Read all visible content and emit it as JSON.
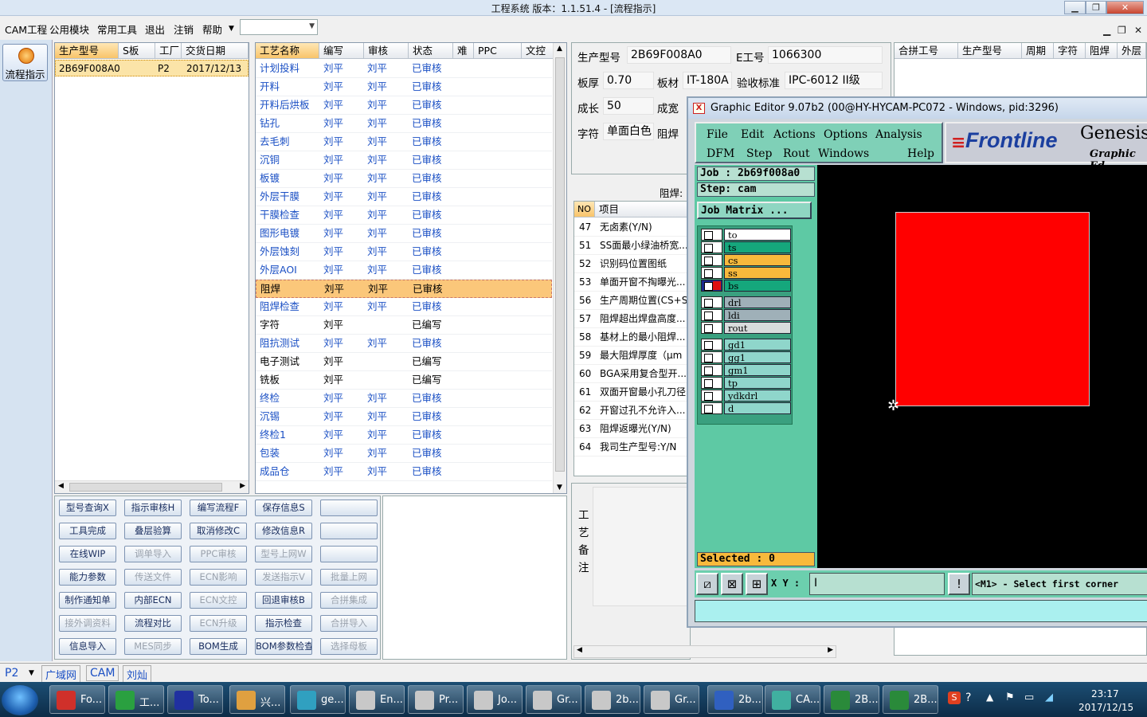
{
  "window": {
    "title": "工程系统    版本：1.1.51.4 - [流程指示]"
  },
  "menu": [
    "CAM工程",
    "公用模块",
    "常用工具",
    "退出",
    "注销",
    "帮助"
  ],
  "left_bar": {
    "flow_button": "流程指示"
  },
  "order_table": {
    "headers": [
      "生产型号",
      "S板",
      "工厂",
      "交货日期"
    ],
    "row": {
      "model": "2B69F008A0",
      "s": "",
      "factory": "P2",
      "date": "2017/12/13"
    }
  },
  "process_table": {
    "headers": [
      "工艺名称",
      "编写",
      "审核",
      "状态",
      "难",
      "PPC",
      "文控"
    ],
    "rows": [
      {
        "name": "计划投料",
        "writer": "刘平",
        "reviewer": "刘平",
        "status": "已审核"
      },
      {
        "name": "开料",
        "writer": "刘平",
        "reviewer": "刘平",
        "status": "已审核"
      },
      {
        "name": "开料后烘板",
        "writer": "刘平",
        "reviewer": "刘平",
        "status": "已审核"
      },
      {
        "name": "钻孔",
        "writer": "刘平",
        "reviewer": "刘平",
        "status": "已审核"
      },
      {
        "name": "去毛刺",
        "writer": "刘平",
        "reviewer": "刘平",
        "status": "已审核"
      },
      {
        "name": "沉铜",
        "writer": "刘平",
        "reviewer": "刘平",
        "status": "已审核"
      },
      {
        "name": "板镀",
        "writer": "刘平",
        "reviewer": "刘平",
        "status": "已审核"
      },
      {
        "name": "外层干膜",
        "writer": "刘平",
        "reviewer": "刘平",
        "status": "已审核"
      },
      {
        "name": "干膜检查",
        "writer": "刘平",
        "reviewer": "刘平",
        "status": "已审核"
      },
      {
        "name": "图形电镀",
        "writer": "刘平",
        "reviewer": "刘平",
        "status": "已审核"
      },
      {
        "name": "外层蚀刻",
        "writer": "刘平",
        "reviewer": "刘平",
        "status": "已审核"
      },
      {
        "name": "外层AOI",
        "writer": "刘平",
        "reviewer": "刘平",
        "status": "已审核"
      },
      {
        "name": "阻焊",
        "writer": "刘平",
        "reviewer": "刘平",
        "status": "已审核"
      },
      {
        "name": "阻焊检查",
        "writer": "刘平",
        "reviewer": "刘平",
        "status": "已审核"
      },
      {
        "name": "字符",
        "writer": "刘平",
        "reviewer": "",
        "status": "已编写"
      },
      {
        "name": "阻抗测试",
        "writer": "刘平",
        "reviewer": "刘平",
        "status": "已审核"
      },
      {
        "name": "电子测试",
        "writer": "刘平",
        "reviewer": "",
        "status": "已编写"
      },
      {
        "name": "铣板",
        "writer": "刘平",
        "reviewer": "",
        "status": "已编写"
      },
      {
        "name": "终检",
        "writer": "刘平",
        "reviewer": "刘平",
        "status": "已审核"
      },
      {
        "name": "沉锡",
        "writer": "刘平",
        "reviewer": "刘平",
        "status": "已审核"
      },
      {
        "name": "终检1",
        "writer": "刘平",
        "reviewer": "刘平",
        "status": "已审核"
      },
      {
        "name": "包装",
        "writer": "刘平",
        "reviewer": "刘平",
        "status": "已审核"
      },
      {
        "name": "成品仓",
        "writer": "刘平",
        "reviewer": "刘平",
        "status": "已审核"
      }
    ]
  },
  "buttons": [
    [
      "型号查询X",
      "指示审核H",
      "编写流程F",
      "保存信息S",
      ""
    ],
    [
      "工具完成",
      "叠层验算",
      "取消修改C",
      "修改信息R",
      ""
    ],
    [
      "在线WIP",
      "调单导入",
      "PPC审核",
      "型号上网W",
      ""
    ],
    [
      "能力参数",
      "传送文件",
      "ECN影响",
      "发送指示V",
      "批量上网"
    ],
    [
      "制作通知单",
      "内部ECN",
      "ECN文控",
      "回退审核B",
      "合拼集成"
    ],
    [
      "接外调资料",
      "流程对比",
      "ECN升级",
      "指示检查",
      "合拼导入"
    ],
    [
      "信息导入",
      "MES同步",
      "BOM生成",
      "BOM参数检查",
      "选择母板"
    ]
  ],
  "info": {
    "model_label": "生产型号",
    "model": "2B69F008A0",
    "eno_label": "E工号",
    "eno": "1066300",
    "thickness_label": "板厚",
    "thickness": "0.70",
    "material_label": "板材",
    "material": "IT-180A",
    "standard_label": "验收标准",
    "standard": "IPC-6012 II级",
    "length_label": "成长",
    "length": "50",
    "width_label": "成宽",
    "char_label": "字符",
    "char": "单面白色",
    "mask_label": "阻焊"
  },
  "right_table": {
    "headers": [
      "合拼工号",
      "生产型号",
      "周期",
      "字符",
      "阻焊",
      "外层"
    ]
  },
  "requirements": {
    "title": "阻焊:",
    "headers": [
      "NO",
      "项目"
    ],
    "rows": [
      {
        "no": "47",
        "item": "无卤素(Y/N)"
      },
      {
        "no": "51",
        "item": "SS面最小绿油桥宽..."
      },
      {
        "no": "52",
        "item": "识别码位置图纸"
      },
      {
        "no": "53",
        "item": "单面开窗不掏曝光..."
      },
      {
        "no": "56",
        "item": "生产周期位置(CS+S"
      },
      {
        "no": "57",
        "item": "阻焊超出焊盘高度..."
      },
      {
        "no": "58",
        "item": "基材上的最小阻焊..."
      },
      {
        "no": "59",
        "item": "最大阻焊厚度（μm"
      },
      {
        "no": "60",
        "item": "BGA采用复合型开..."
      },
      {
        "no": "61",
        "item": "双面开窗最小孔刀径"
      },
      {
        "no": "62",
        "item": "开窗过孔不允许入..."
      },
      {
        "no": "63",
        "item": "阻焊返曝光(Y/N)"
      },
      {
        "no": "64",
        "item": "我司生产型号:Y/N"
      }
    ]
  },
  "notes": {
    "label": [
      "工",
      "艺",
      "备",
      "注"
    ]
  },
  "genesis": {
    "title": "Graphic Editor 9.07b2 (00@HY-HYCAM-PC072 - Windows, pid:3296)",
    "menu_row1": [
      "File",
      "Edit",
      "Actions",
      "Options",
      "Analysis"
    ],
    "menu_row2": [
      "DFM",
      "Step",
      "Rout",
      "Windows",
      "Help"
    ],
    "logo": "Frontline",
    "logo_right": "Genesis",
    "logo_sub": "Graphic Ed",
    "job": "Job  :  2b69f008a0",
    "step": "Step:  cam",
    "job_matrix": "Job Matrix  ...",
    "selected": "Selected : 0",
    "xy_label": "X Y :",
    "prompt": "<M1> - Select first corner",
    "layers": [
      {
        "name": "to",
        "color": "#ffffff"
      },
      {
        "name": "ts",
        "color": "#15a77c"
      },
      {
        "name": "cs",
        "color": "#f8b93c"
      },
      {
        "name": "ss",
        "color": "#f8b93c"
      },
      {
        "name": "bs",
        "color": "#15a77c"
      },
      {
        "name": "drl",
        "color": "#9fb0b8"
      },
      {
        "name": "ldi",
        "color": "#9fb0b8"
      },
      {
        "name": "rout",
        "color": "#d8dcdc"
      },
      {
        "name": "gd1",
        "color": "#8fd6cb"
      },
      {
        "name": "gg1",
        "color": "#8fd6cb"
      },
      {
        "name": "gm1",
        "color": "#8fd6cb"
      },
      {
        "name": "tp",
        "color": "#8fd6cb"
      },
      {
        "name": "ydkdrl",
        "color": "#8fd6cb"
      },
      {
        "name": "d",
        "color": "#8fd6cb"
      }
    ]
  },
  "status_bar": {
    "combo": "P2",
    "tabs": [
      "广域网",
      "CAM",
      "刘灿"
    ]
  },
  "taskbar": {
    "items": [
      "Fo...",
      "工...",
      "To...",
      "兴...",
      "ge...",
      "En...",
      "Pr...",
      "Jo...",
      "Gr...",
      "2b...",
      "Gr...",
      "2b...",
      "CA...",
      "2B...",
      "2B..."
    ],
    "time": "23:17",
    "date": "2017/12/15"
  }
}
